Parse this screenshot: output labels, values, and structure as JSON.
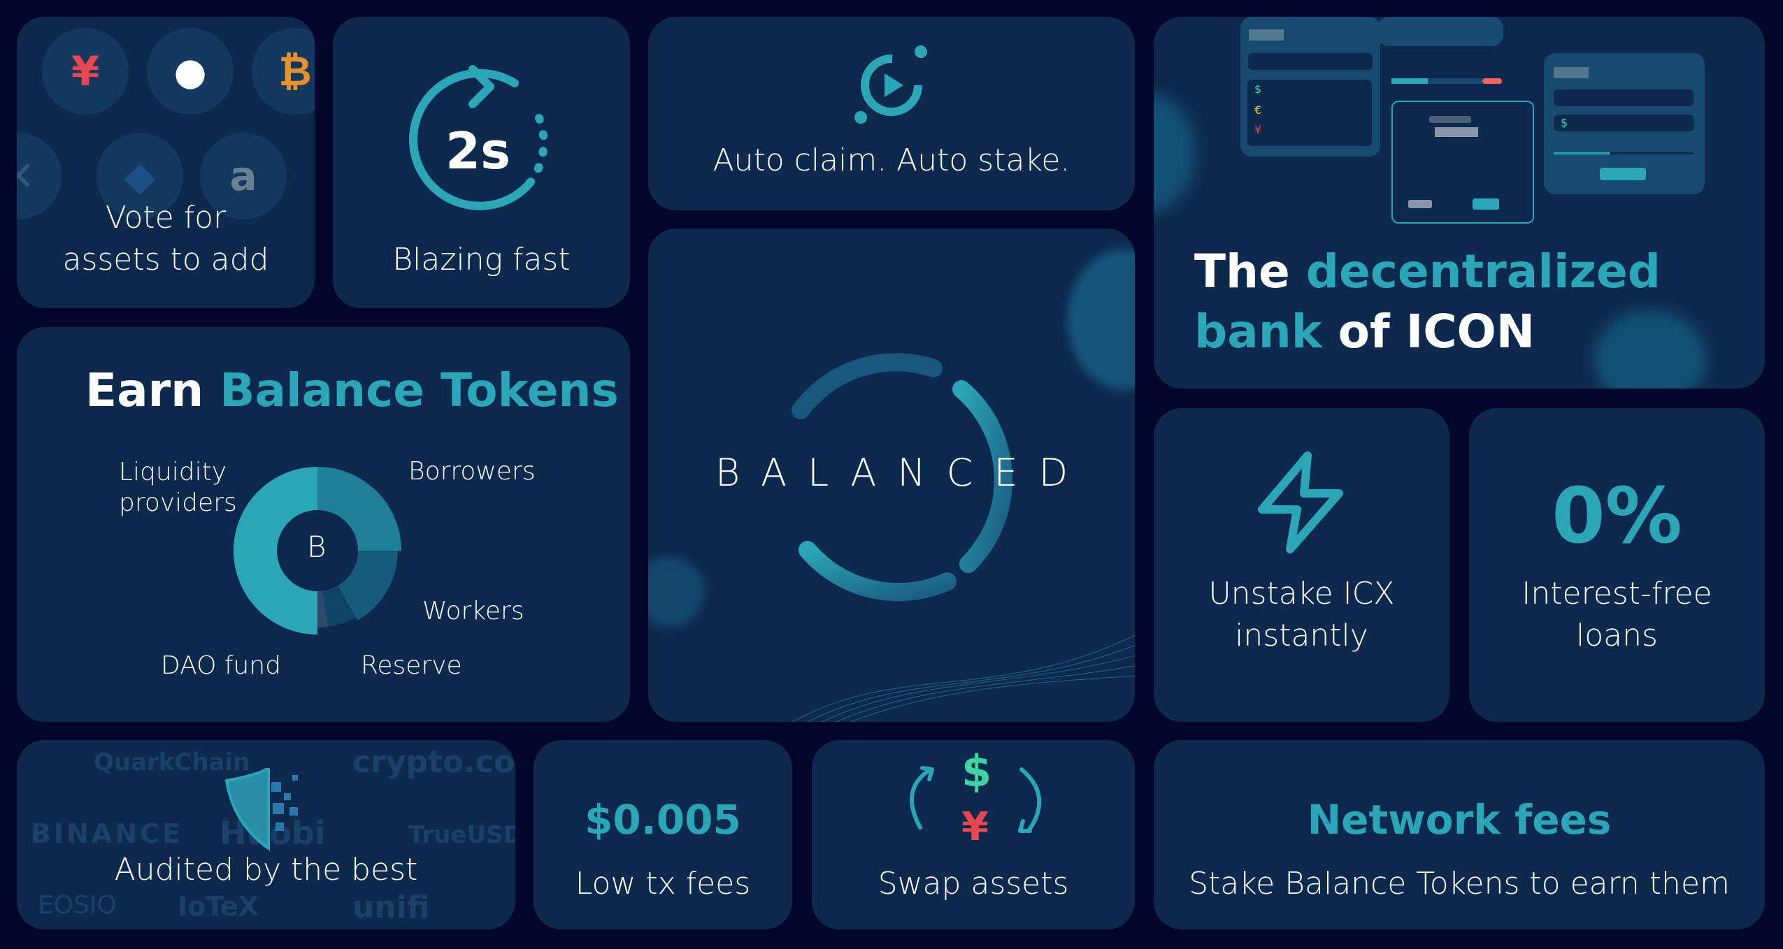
{
  "colors": {
    "background": "#03062b",
    "card": "#0d2a4e",
    "accent": "#2aa6b6",
    "red": "#e8474f",
    "green": "#3ed3a3"
  },
  "vote": {
    "line1": "Vote for",
    "line2": "assets to add",
    "coins": [
      "¥",
      "",
      "₿",
      "✕",
      "◆",
      "a"
    ]
  },
  "fast": {
    "value": "2s",
    "label": "Blazing fast"
  },
  "auto": {
    "label": "Auto claim. Auto stake."
  },
  "bank": {
    "w1": "The",
    "w2": "decentralized",
    "w3": "bank",
    "w4": "of ICON",
    "symbols": [
      "$",
      "€",
      "¥",
      "$"
    ]
  },
  "earn": {
    "w1": "Earn",
    "w2": "Balance Tokens",
    "center": "B",
    "segments": [
      {
        "label": "Liquidity providers",
        "line1": "Liquidity",
        "line2": "providers"
      },
      {
        "label": "Borrowers"
      },
      {
        "label": "Workers"
      },
      {
        "label": "Reserve"
      },
      {
        "label": "DAO fund"
      }
    ]
  },
  "brand": {
    "name": "BALANCED"
  },
  "unstake": {
    "line1": "Unstake ICX",
    "line2": "instantly"
  },
  "loans": {
    "value": "0%",
    "line1": "Interest-free",
    "line2": "loans"
  },
  "audited": {
    "label": "Audited by the best",
    "logos": [
      "QuarkChain",
      "crypto.com",
      "BINANCE",
      "Huobi",
      "TrueUSD",
      "EOSIO",
      "IoTeX",
      "unifi"
    ]
  },
  "fees": {
    "value": "$0.005",
    "label": "Low tx fees"
  },
  "swap": {
    "label": "Swap assets",
    "top": "$",
    "bottom": "¥"
  },
  "network": {
    "title": "Network fees",
    "label": "Stake Balance Tokens to earn them"
  }
}
